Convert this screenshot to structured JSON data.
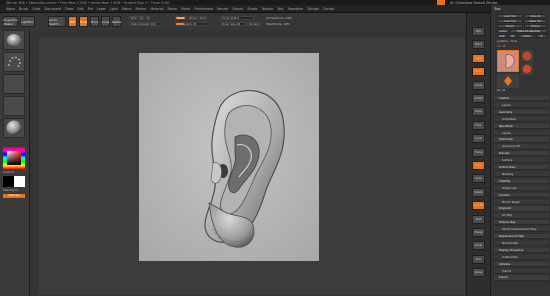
{
  "colors": {
    "accent": "#e8731a",
    "bg": "#2b2b2b",
    "panel": "#363636",
    "canvas_sculpt": "#b7b7b7"
  },
  "title_bar": {
    "text": "ZBrush 4R8 • ZBrushDocument • Free Mem 2.5GB • Active Mem 1.9GB • Scratch Disk 0 • Timer 0.001",
    "right_text": "AC  QuickSave  Default ZScript"
  },
  "menu": [
    "Alpha",
    "Brush",
    "Color",
    "Document",
    "Draw",
    "Edit",
    "File",
    "Layer",
    "Light",
    "Macro",
    "Marker",
    "Material",
    "Movie",
    "Picker",
    "Preferences",
    "Render",
    "Stencil",
    "Stroke",
    "Texture",
    "Tool",
    "Transform",
    "Zplugin",
    "Zscript"
  ],
  "shelf": {
    "projection_master": "Projection Master",
    "lightbox": "LightBox",
    "quick_sketch": "Quick Sketch",
    "edit": "Edit",
    "draw": "Draw",
    "move": "Move",
    "scale": "Scale",
    "rotate": "Rotate",
    "mrgb": "Mrgb",
    "rgb": "Rgb",
    "m": "M",
    "zadd": "Zadd",
    "zsub": "Zsub",
    "zcut": "Zcut",
    "rgb_intensity": "Rgb Intensity 100",
    "z_intensity": "Z Intensity 25",
    "focal_shift": "Focal Shift 0",
    "draw_size": "Draw Size 64",
    "dynamic": "Dynamic",
    "active_points": "ActivePoints: 16M",
    "total_points": "TotalPoints: 16M"
  },
  "left_panel": {
    "gradient": "Gradient",
    "switch_color": "SwitchColor",
    "alternate": "Alternate"
  },
  "right_tools": [
    "BPR",
    "SPix 3",
    "Scroll",
    "Zoom",
    "Actual",
    "AAHalf",
    "Persp",
    "Floor",
    "Local",
    "Frame",
    "Move",
    "Scale",
    "Rotate",
    "Line Fill",
    "PolyF",
    "Transp",
    "Ghost",
    "Solo",
    "Xpose"
  ],
  "tray": {
    "title": "Tool",
    "load_tool": "Load Tool",
    "save_as": "Save As",
    "copy_tool": "Copy Tool",
    "paste_tool": "Paste Tool",
    "import": "Import",
    "export": "Export",
    "clone": "Clone",
    "make_polymesh": "Make PolyMesh3D",
    "goz": "GoZ",
    "all": "All",
    "visible": "Visible",
    "r": "R",
    "lightbox_tools": "Lightbox › Tools",
    "current_tool": "Ear 48",
    "tools": [
      "Ear_48",
      "Sphere3D",
      "SimpleBrush",
      "PolyMesh3D"
    ],
    "menus": [
      "Subtool",
      "Layers",
      "Geometry",
      "ArrayMesh",
      "NanoMesh",
      "Layers",
      "Fibermesh",
      "Geometry HD",
      "Preview",
      "Surface",
      "Deformation",
      "Masking",
      "Visibility",
      "Polygroups",
      "Contact",
      "Morph Target",
      "Polypaint",
      "UV Map",
      "Texture Map",
      "Vector Displacement Map",
      "Displacement Map",
      "Normal Map",
      "Display Properties",
      "Unified Skin",
      "Initialize",
      "Import",
      "Export"
    ]
  }
}
